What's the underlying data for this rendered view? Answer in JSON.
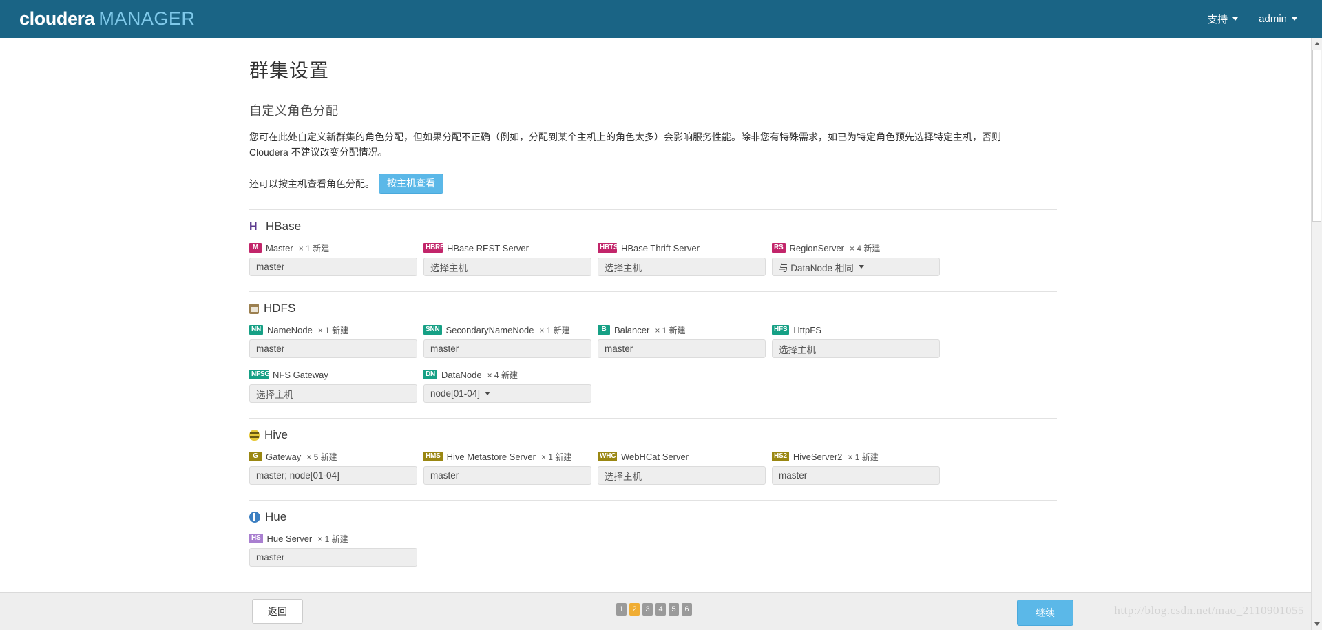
{
  "topbar": {
    "brand_main": "cloudera",
    "brand_sub": "MANAGER",
    "support_label": "支持",
    "user_label": "admin"
  },
  "page": {
    "title": "群集设置",
    "subtitle": "自定义角色分配",
    "description": "您可在此处自定义新群集的角色分配，但如果分配不正确（例如，分配到某个主机上的角色太多）会影响服务性能。除非您有特殊需求，如已为特定角色预先选择特定主机，否则 Cloudera 不建议改变分配情况。",
    "view_by_host_label": "还可以按主机查看角色分配。",
    "view_by_host_button": "按主机查看"
  },
  "services": [
    {
      "name": "HBase",
      "icon": "hbase-icon",
      "roles": [
        {
          "badge": "M",
          "badge_color": "#c2256a",
          "name": "Master",
          "count": "× 1 新建",
          "value": "master",
          "is_placeholder": false,
          "dropdown": false
        },
        {
          "badge": "HBRE",
          "badge_color": "#c2256a",
          "name": "HBase REST Server",
          "count": "",
          "value": "选择主机",
          "is_placeholder": true,
          "dropdown": false
        },
        {
          "badge": "HBTS",
          "badge_color": "#c2256a",
          "name": "HBase Thrift Server",
          "count": "",
          "value": "选择主机",
          "is_placeholder": true,
          "dropdown": false
        },
        {
          "badge": "RS",
          "badge_color": "#c2256a",
          "name": "RegionServer",
          "count": "× 4 新建",
          "value": "与 DataNode 相同",
          "is_placeholder": false,
          "dropdown": true
        }
      ]
    },
    {
      "name": "HDFS",
      "icon": "hdfs-icon",
      "roles": [
        {
          "badge": "NN",
          "badge_color": "#16a085",
          "name": "NameNode",
          "count": "× 1 新建",
          "value": "master",
          "is_placeholder": false,
          "dropdown": false
        },
        {
          "badge": "SNN",
          "badge_color": "#16a085",
          "name": "SecondaryNameNode",
          "count": "× 1 新建",
          "value": "master",
          "is_placeholder": false,
          "dropdown": false
        },
        {
          "badge": "B",
          "badge_color": "#16a085",
          "name": "Balancer",
          "count": "× 1 新建",
          "value": "master",
          "is_placeholder": false,
          "dropdown": false
        },
        {
          "badge": "HFS",
          "badge_color": "#16a085",
          "name": "HttpFS",
          "count": "",
          "value": "选择主机",
          "is_placeholder": true,
          "dropdown": false
        },
        {
          "badge": "NFSG",
          "badge_color": "#16a085",
          "name": "NFS Gateway",
          "count": "",
          "value": "选择主机",
          "is_placeholder": true,
          "dropdown": false
        },
        {
          "badge": "DN",
          "badge_color": "#16a085",
          "name": "DataNode",
          "count": "× 4 新建",
          "value": "node[01-04]",
          "is_placeholder": false,
          "dropdown": true
        }
      ]
    },
    {
      "name": "Hive",
      "icon": "hive-icon",
      "roles": [
        {
          "badge": "G",
          "badge_color": "#9a8712",
          "name": "Gateway",
          "count": "× 5 新建",
          "value": "master; node[01-04]",
          "is_placeholder": false,
          "dropdown": false
        },
        {
          "badge": "HMS",
          "badge_color": "#9a8712",
          "name": "Hive Metastore Server",
          "count": "× 1 新建",
          "value": "master",
          "is_placeholder": false,
          "dropdown": false
        },
        {
          "badge": "WHC",
          "badge_color": "#9a8712",
          "name": "WebHCat Server",
          "count": "",
          "value": "选择主机",
          "is_placeholder": true,
          "dropdown": false
        },
        {
          "badge": "HS2",
          "badge_color": "#9a8712",
          "name": "HiveServer2",
          "count": "× 1 新建",
          "value": "master",
          "is_placeholder": false,
          "dropdown": false
        }
      ]
    },
    {
      "name": "Hue",
      "icon": "hue-icon",
      "roles": [
        {
          "badge": "HS",
          "badge_color": "#a97fd0",
          "name": "Hue Server",
          "count": "× 1 新建",
          "value": "master",
          "is_placeholder": false,
          "dropdown": false
        }
      ]
    }
  ],
  "footer": {
    "back_label": "返回",
    "continue_label": "继续",
    "pages": [
      "1",
      "2",
      "3",
      "4",
      "5",
      "6"
    ],
    "active_page": "2",
    "watermark": "http://blog.csdn.net/mao_2110901055"
  }
}
